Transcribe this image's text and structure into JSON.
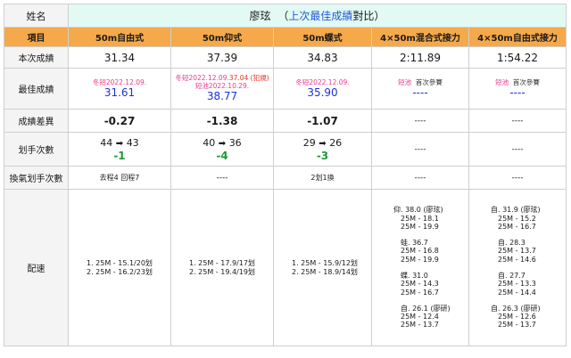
{
  "name_label": "姓名",
  "swimmer": {
    "name": "廖玹",
    "open": "（",
    "highlight": "上次最佳成績",
    "suffix": "對比）"
  },
  "header": {
    "item": "項目",
    "events": [
      "50m自由式",
      "50m仰式",
      "50m蝶式",
      "4×50m混合式接力",
      "4×50m自由式接力"
    ]
  },
  "rows": {
    "current": {
      "label": "本次成績",
      "values": [
        "31.34",
        "37.39",
        "34.83",
        "2:11.89",
        "1:54.22"
      ]
    },
    "best": {
      "label": "最佳成績",
      "free": {
        "note": "冬短2022.12.09.",
        "time": "31.61"
      },
      "back": {
        "note1": "冬短2022.12.09.",
        "note1_red": "37.04 (犯規)",
        "note2": "短池2022.10.29.",
        "time": "38.77"
      },
      "fly": {
        "note": "冬短2022.12.09.",
        "time": "35.90"
      },
      "medley": {
        "note_pink": "短池",
        "note_black": "首次參賽",
        "time": "----"
      },
      "freerelay": {
        "note_pink": "短池",
        "note_black": "首次參賽",
        "time": "----"
      }
    },
    "diff": {
      "label": "成績差異",
      "values": [
        "-0.27",
        "-1.38",
        "-1.07",
        "----",
        "----"
      ]
    },
    "strokes": {
      "label": "划手次數",
      "free": {
        "before": "44",
        "arrow": "➡",
        "after": "43",
        "delta": "-1"
      },
      "back": {
        "before": "40",
        "arrow": "➡",
        "after": "36",
        "delta": "-4"
      },
      "fly": {
        "before": "29",
        "arrow": "➡",
        "after": "26",
        "delta": "-3"
      },
      "medley": "----",
      "freerelay": "----"
    },
    "breath": {
      "label": "換氣划手次數",
      "values": [
        "去程4 回程7",
        "----",
        "2划1換",
        "----",
        "----"
      ]
    },
    "pace": {
      "label": "配速",
      "free": [
        "1. 25M - 15.1/20划",
        "2. 25M - 16.2/23划"
      ],
      "back": [
        "1. 25M - 17.9/17划",
        "2. 25M - 19.4/19划"
      ],
      "fly": [
        "1. 25M - 15.9/12划",
        "2. 25M - 18.9/14划"
      ],
      "medley": [
        {
          "head": "仰. 38.0 (廖玹)",
          "s1": "25M - 18.1",
          "s2": "25M - 19.9"
        },
        {
          "head": "蛙. 36.7",
          "s1": "25M - 16.8",
          "s2": "25M - 19.9"
        },
        {
          "head": "蝶. 31.0",
          "s1": "25M - 14.3",
          "s2": "25M - 16.7"
        },
        {
          "head": "自. 26.1 (廖研)",
          "s1": "25M - 12.4",
          "s2": "25M - 13.7"
        }
      ],
      "freerelay": [
        {
          "head": "自. 31.9 (廖玹)",
          "s1": "25M - 15.2",
          "s2": "25M - 16.7"
        },
        {
          "head": "自. 28.3",
          "s1": "25M - 13.7",
          "s2": "25M - 14.6"
        },
        {
          "head": "自. 27.7",
          "s1": "25M - 13.3",
          "s2": "25M - 14.4"
        },
        {
          "head": "自. 26.3 (廖研)",
          "s1": "25M - 12.6",
          "s2": "25M - 13.7"
        }
      ]
    }
  }
}
